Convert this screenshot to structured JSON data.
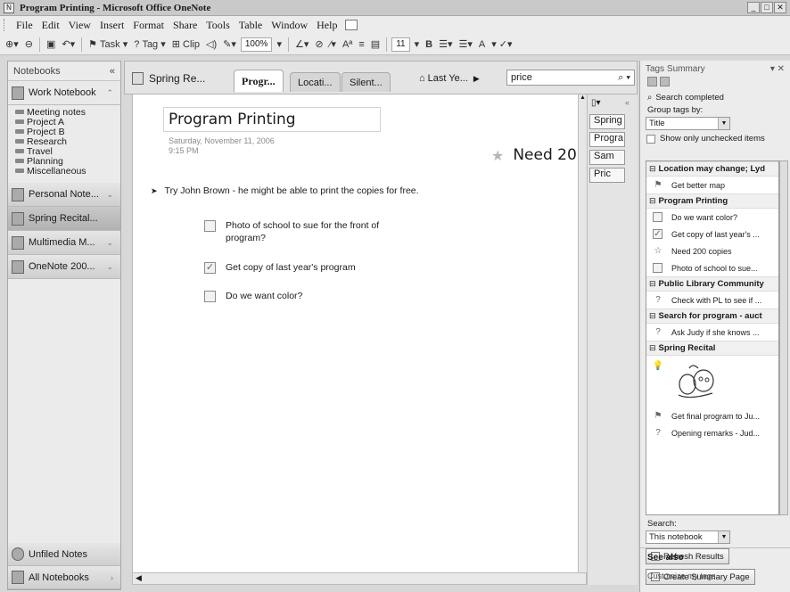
{
  "window": {
    "title": "Program Printing - Microsoft Office OneNote"
  },
  "menu": {
    "items": [
      "File",
      "Edit",
      "View",
      "Insert",
      "Format",
      "Share",
      "Tools",
      "Table",
      "Window",
      "Help"
    ]
  },
  "toolbar": {
    "task_label": "Task",
    "tag_label": "Tag",
    "clip_label": "Clip",
    "zoom": "100%",
    "font_size": "11",
    "bold_label": "B",
    "font_color_label": "A"
  },
  "nav": {
    "header": "Notebooks",
    "collapse_glyph": "«",
    "work_notebook": "Work Notebook",
    "sections": [
      "Meeting notes",
      "Project A",
      "Project B",
      "Research",
      "Travel",
      "Planning",
      "Miscellaneous"
    ],
    "notebooks": [
      "Personal Note...",
      "Spring Recital...",
      "Multimedia M...",
      "OneNote 200..."
    ],
    "unfiled": "Unfiled Notes",
    "all_notebooks": "All Notebooks"
  },
  "tabs": {
    "notebook_title": "Spring Re...",
    "sections": [
      "Progr...",
      "Locati...",
      "Silent..."
    ],
    "last_year": "Last Ye...",
    "search_value": "price"
  },
  "page": {
    "title": "Program Printing",
    "date": "Saturday, November 11, 2006",
    "time": "9:15 PM",
    "outline_text": "Try John Brown - he might be able to print the copies for free.",
    "todos": [
      {
        "text": "Photo of school  to sue for the front of program?",
        "checked": false
      },
      {
        "text": "Get copy of last year's program",
        "checked": true
      },
      {
        "text": "Do we want color?",
        "checked": false
      }
    ],
    "star_note": "Need 20"
  },
  "page_tabs": [
    "Spring",
    "Progra",
    "Sam",
    "Pric"
  ],
  "tags_pane": {
    "title": "Tags Summary",
    "search_completed": "Search completed",
    "group_by_label": "Group tags by:",
    "group_by_value": "Title",
    "show_unchecked": "Show only unchecked items",
    "groups": [
      {
        "name": "Location may change; Lyd",
        "items": [
          {
            "icon": "flag",
            "text": "Get better map"
          }
        ]
      },
      {
        "name": "Program Printing",
        "items": [
          {
            "icon": "checkbox",
            "text": "Do we want color?"
          },
          {
            "icon": "checkbox-checked",
            "text": "Get copy of last year's ..."
          },
          {
            "icon": "star",
            "text": "Need 200 copies"
          },
          {
            "icon": "checkbox",
            "text": "Photo of school  to sue..."
          }
        ]
      },
      {
        "name": "Public Library Community",
        "items": [
          {
            "icon": "question",
            "text": "Check with PL to see if ..."
          }
        ]
      },
      {
        "name": "Search for program - auct",
        "items": [
          {
            "icon": "question",
            "text": "Ask Judy if she knows ..."
          }
        ]
      },
      {
        "name": "Spring Recital",
        "items": [
          {
            "icon": "idea",
            "text": ""
          },
          {
            "icon": "flag",
            "text": "Get final program to Ju..."
          },
          {
            "icon": "question",
            "text": "Opening remarks - Jud..."
          }
        ]
      }
    ],
    "search_label": "Search:",
    "search_scope": "This notebook",
    "refresh_button": "Refresh Results",
    "create_summary_button": "Create Summary Page",
    "see_also": "See also",
    "customize_link": "Customize my tags"
  }
}
